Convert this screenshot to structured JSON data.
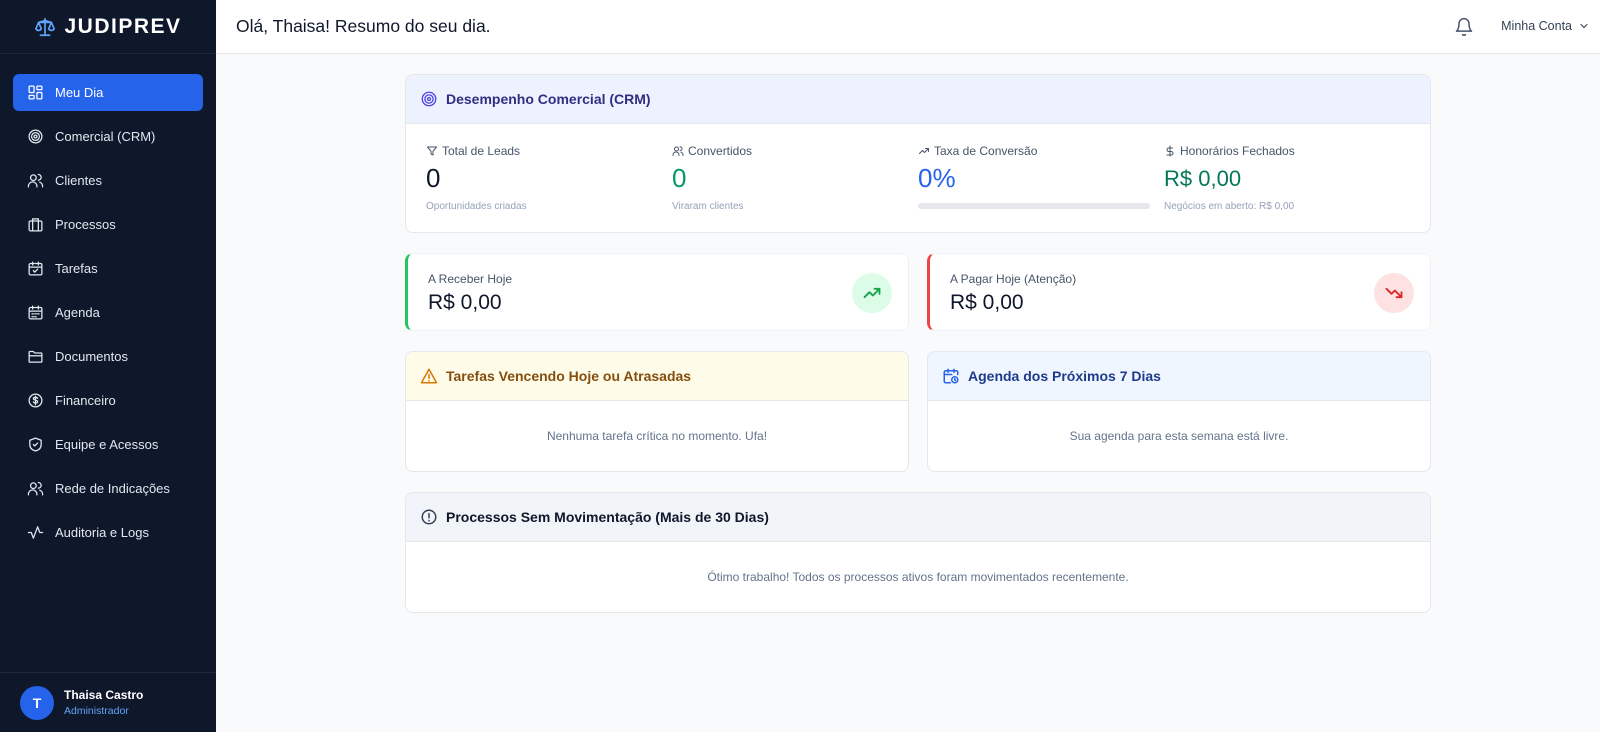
{
  "brand": {
    "name": "JUDIPREV",
    "icon": "scale-icon"
  },
  "sidebar": {
    "items": [
      {
        "label": "Meu Dia",
        "icon": "grid-icon",
        "active": true
      },
      {
        "label": "Comercial (CRM)",
        "icon": "target-icon"
      },
      {
        "label": "Clientes",
        "icon": "users-icon"
      },
      {
        "label": "Processos",
        "icon": "briefcase-icon"
      },
      {
        "label": "Tarefas",
        "icon": "calendar-check-icon"
      },
      {
        "label": "Agenda",
        "icon": "calendar-icon"
      },
      {
        "label": "Documentos",
        "icon": "folder-icon"
      },
      {
        "label": "Financeiro",
        "icon": "dollar-circle-icon"
      },
      {
        "label": "Equipe e Acessos",
        "icon": "shield-icon"
      },
      {
        "label": "Rede de Indicações",
        "icon": "users-icon"
      },
      {
        "label": "Auditoria e Logs",
        "icon": "activity-icon"
      }
    ],
    "user": {
      "initial": "T",
      "name": "Thaisa Castro",
      "role": "Administrador"
    }
  },
  "header": {
    "greeting": "Olá, Thaisa! Resumo do seu dia.",
    "account": "Minha Conta"
  },
  "crm": {
    "title": "Desempenho Comercial (CRM)",
    "kpis": [
      {
        "label": "Total de Leads",
        "value": "0",
        "sub": "Oportunidades criadas",
        "icon": "filter-icon",
        "color": "#0f172a"
      },
      {
        "label": "Convertidos",
        "value": "0",
        "sub": "Viraram clientes",
        "icon": "users-icon",
        "color": "#059669"
      },
      {
        "label": "Taxa de Conversão",
        "value": "0%",
        "progress": 0,
        "icon": "trending-up-icon",
        "color": "#2563eb"
      },
      {
        "label": "Honorários Fechados",
        "value": "R$ 0,00",
        "sub": "Negócios em aberto: R$ 0,00",
        "icon": "dollar-icon",
        "color": "#047857"
      }
    ]
  },
  "finance": {
    "receive": {
      "label": "A Receber Hoje",
      "value": "R$ 0,00",
      "accent": "#22c55e"
    },
    "pay": {
      "label": "A Pagar Hoje (Atenção)",
      "value": "R$ 0,00",
      "accent": "#ef4444"
    }
  },
  "tasks": {
    "title": "Tarefas Vencendo Hoje ou Atrasadas",
    "empty": "Nenhuma tarefa crítica no momento. Ufa!"
  },
  "agenda": {
    "title": "Agenda dos Próximos 7 Dias",
    "empty": "Sua agenda para esta semana está livre."
  },
  "stale": {
    "title": "Processos Sem Movimentação (Mais de 30 Dias)",
    "empty": "Ótimo trabalho! Todos os processos ativos foram movimentados recentemente."
  }
}
